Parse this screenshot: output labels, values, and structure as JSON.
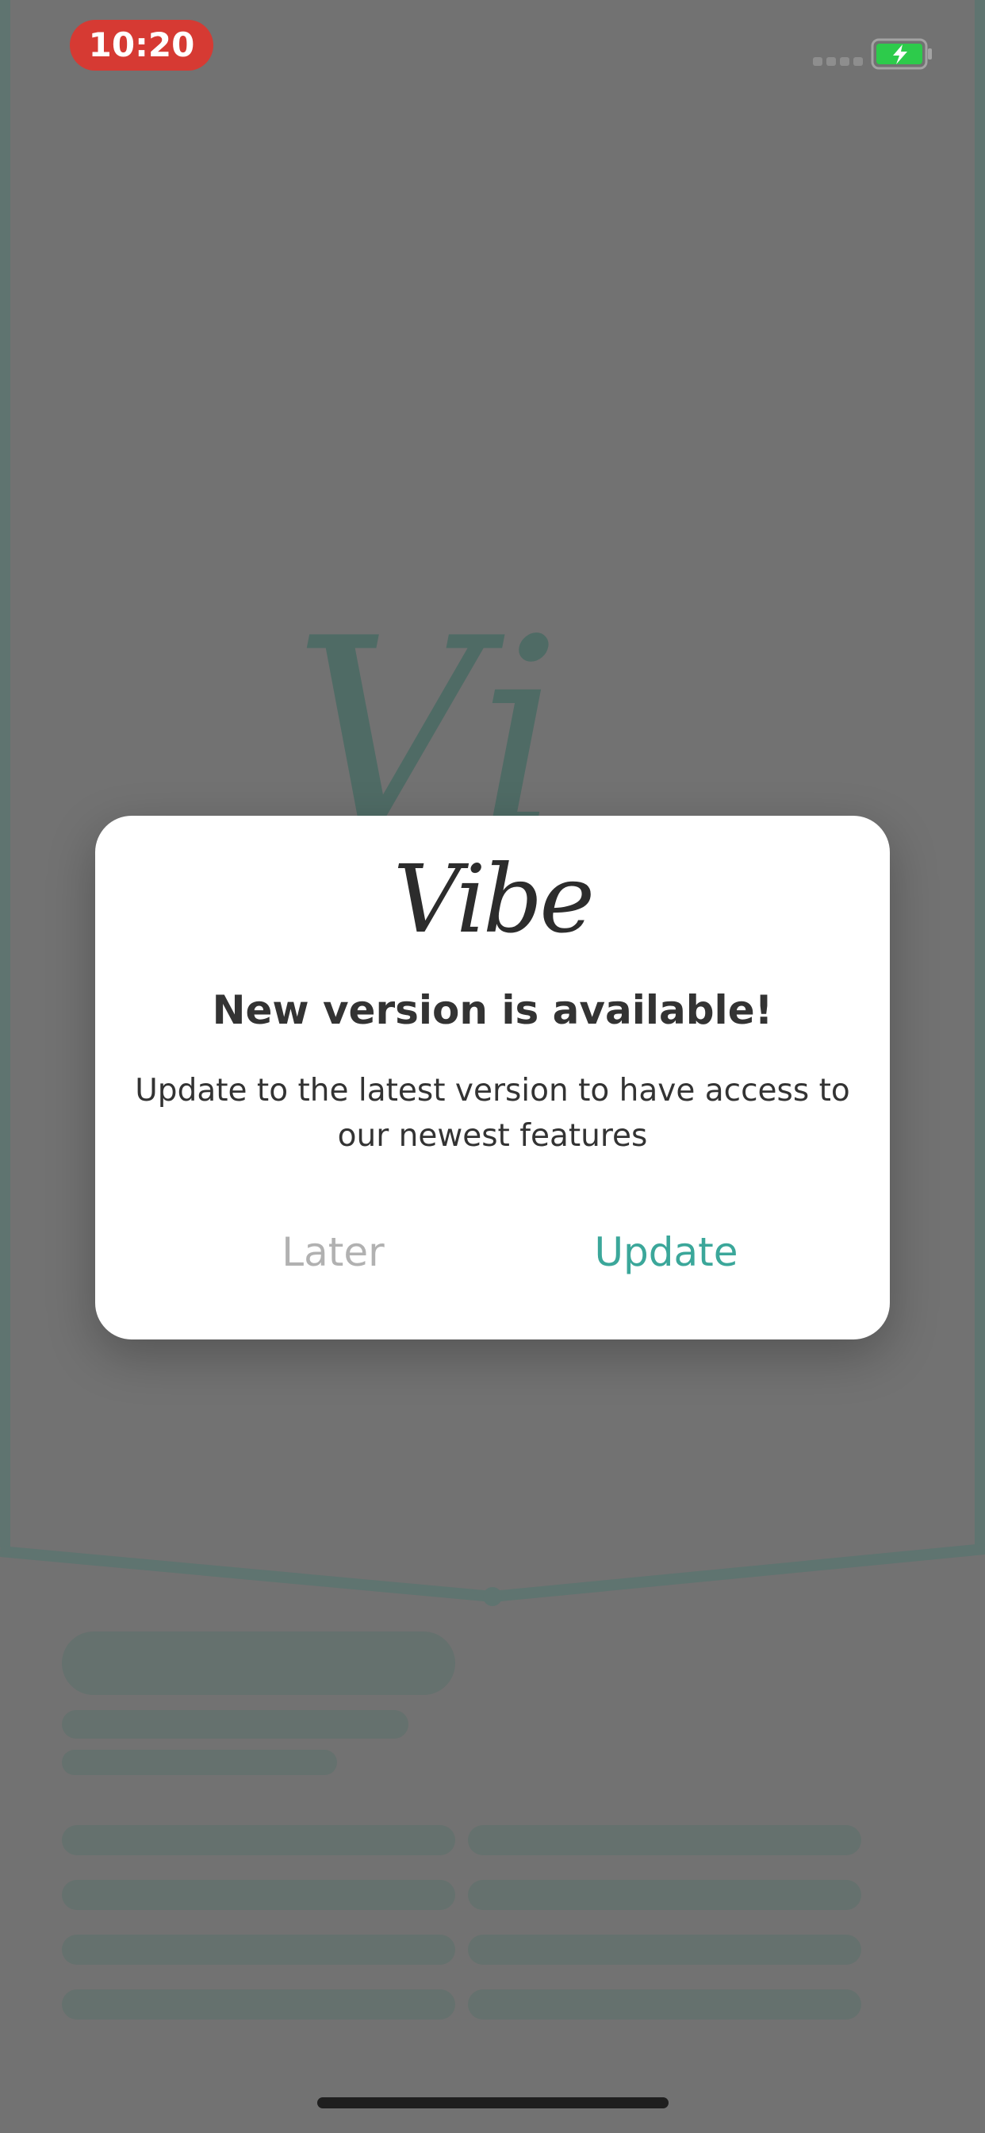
{
  "status_bar": {
    "time": "10:20",
    "time_pill_color": "#d63a33",
    "battery_icon": "battery-charging-icon",
    "signal_icon": "cellular-signal-icon"
  },
  "background": {
    "logo_partial": "Vi",
    "accent_color": "#4f6b65"
  },
  "dialog": {
    "logo": "Vibe",
    "title": "New version is available!",
    "message": "Update to the latest version to have access to our newest features",
    "later_label": "Later",
    "update_label": "Update",
    "update_color": "#3ba79a"
  }
}
